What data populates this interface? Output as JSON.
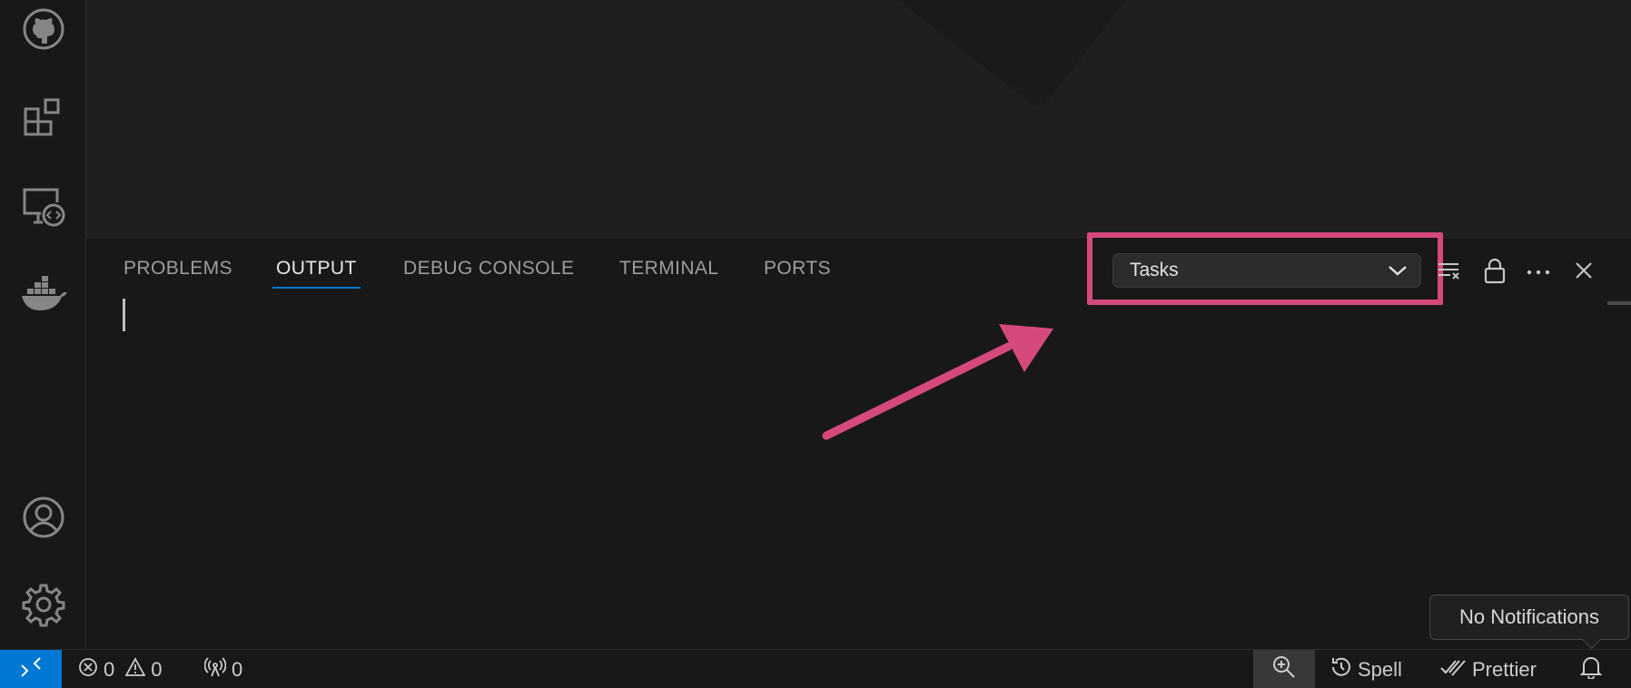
{
  "panel": {
    "tabs": [
      {
        "label": "PROBLEMS",
        "active": false
      },
      {
        "label": "OUTPUT",
        "active": true
      },
      {
        "label": "DEBUG CONSOLE",
        "active": false
      },
      {
        "label": "TERMINAL",
        "active": false
      },
      {
        "label": "PORTS",
        "active": false
      }
    ],
    "output_channel": {
      "selected": "Tasks"
    },
    "actions": {
      "clear_output": "clear-all-icon",
      "lock_scroll": "lock-icon",
      "more": "ellipsis-icon",
      "close": "close-icon"
    }
  },
  "activity_bar": {
    "items": [
      "github-icon",
      "extensions-icon",
      "remote-explorer-icon",
      "docker-icon"
    ],
    "bottom_items": [
      "account-icon",
      "settings-gear-icon"
    ]
  },
  "status_bar": {
    "errors": "0",
    "warnings": "0",
    "ports": "0",
    "spell_label": "Spell",
    "prettier_label": "Prettier"
  },
  "tooltip": {
    "text": "No Notifications"
  },
  "colors": {
    "accent": "#0078d4",
    "highlight": "#d6497d",
    "background": "#1f1f1f"
  }
}
